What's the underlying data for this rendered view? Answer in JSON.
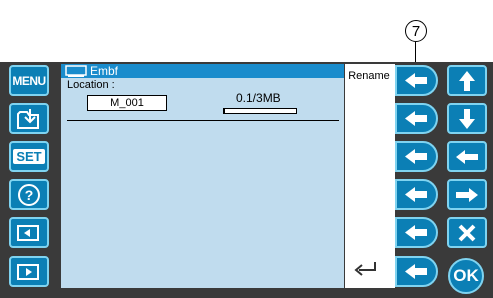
{
  "left_toolbar": {
    "menu_label": "MENU",
    "set_label": "SET"
  },
  "file_panel": {
    "title": "Embf",
    "location_label": "Location :",
    "file_name": "M_001",
    "memory_text": "0.1/3MB",
    "memory_used_fraction": 0.02
  },
  "actions": {
    "rename_label": "Rename"
  },
  "right_toolbar": {
    "ok_label": "OK"
  },
  "annotation": {
    "callout_number": "7"
  },
  "colors": {
    "button_blue": "#0b7fb5",
    "panel_bg": "#c0dcee",
    "title_bar": "#1a8ccc"
  }
}
